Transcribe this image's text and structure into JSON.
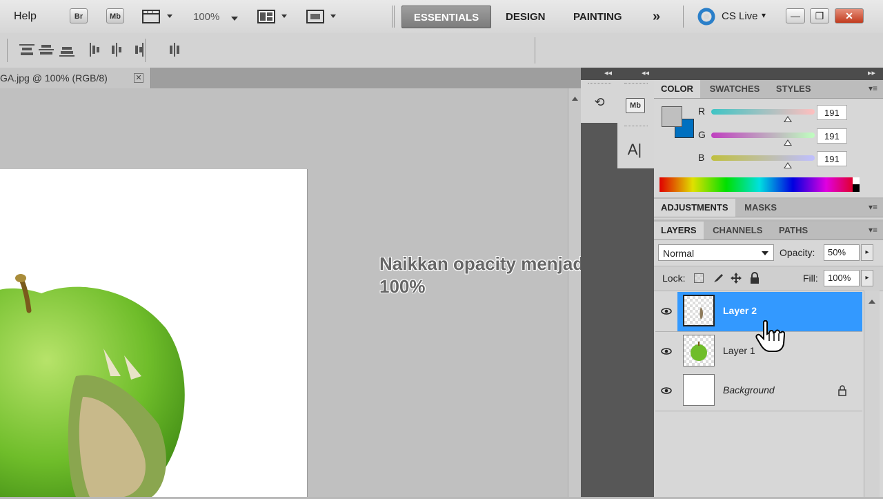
{
  "menubar": {
    "help": "Help",
    "br": "Br",
    "mb": "Mb",
    "zoom": "100%",
    "workspaces": [
      "ESSENTIALS",
      "DESIGN",
      "PAINTING"
    ],
    "more": "»",
    "cslive": "CS Live",
    "cslive_caret": "▾",
    "minimize": "—",
    "restore": "❐",
    "close": "✕"
  },
  "document": {
    "tab_title": "GA.jpg @ 100% (RGB/8)",
    "close": "✕"
  },
  "instruction": {
    "line1": "Naikkan opacity menjadi",
    "line2": "100%"
  },
  "dock": {
    "collapse_left": "◂◂",
    "collapse_left2": "◂◂",
    "expand": "▸▸",
    "history_icon_text": "⟲",
    "mb_icon_text": "Mb",
    "char_icon_text": "A|"
  },
  "color_panel": {
    "tabs": [
      "COLOR",
      "SWATCHES",
      "STYLES"
    ],
    "r_label": "R",
    "g_label": "G",
    "b_label": "B",
    "r_value": "191",
    "g_value": "191",
    "b_value": "191",
    "foreground": "#bfbfbf",
    "background": "#0070c0"
  },
  "adjust_panel": {
    "tabs": [
      "ADJUSTMENTS",
      "MASKS"
    ]
  },
  "layers_panel": {
    "tabs": [
      "LAYERS",
      "CHANNELS",
      "PATHS"
    ],
    "blend_mode": "Normal",
    "opacity_label": "Opacity:",
    "opacity_value": "50%",
    "lock_label": "Lock:",
    "fill_label": "Fill:",
    "fill_value": "100%",
    "layers": [
      {
        "name": "Layer 2",
        "selected": true
      },
      {
        "name": "Layer 1",
        "selected": false
      },
      {
        "name": "Background",
        "selected": false,
        "locked": true
      }
    ]
  },
  "colors": {
    "selection": "#3399ff",
    "essentials_bg": "#8a8a8a"
  }
}
